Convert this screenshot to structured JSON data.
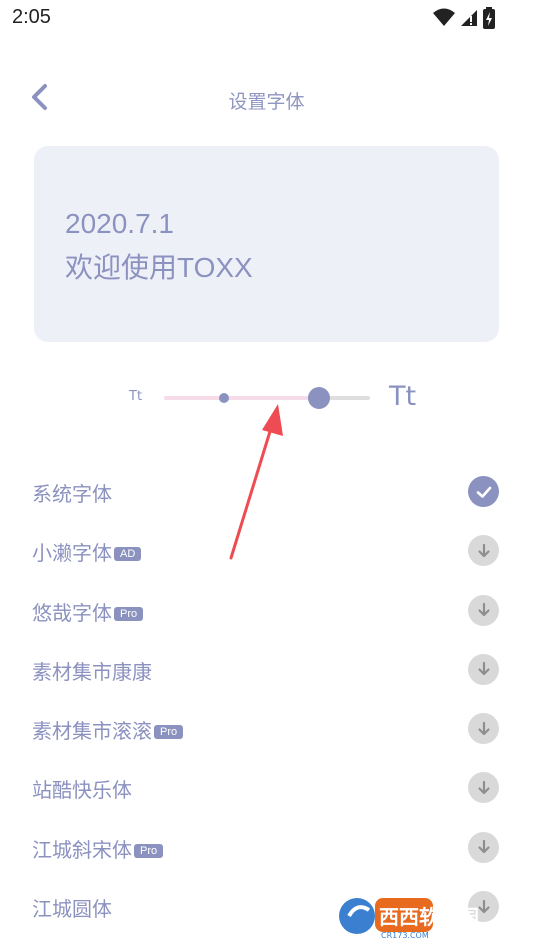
{
  "status_bar": {
    "time": "2:05"
  },
  "header": {
    "title": "设置字体"
  },
  "preview": {
    "line1": "2020.7.1",
    "line2": "欢迎使用TOXX"
  },
  "size_slider": {
    "small_label": "Tt",
    "large_label": "Tt",
    "value_fraction": 0.75,
    "tick_fraction": 0.29
  },
  "fonts": [
    {
      "name": "系统字体",
      "badge": "",
      "status": "selected"
    },
    {
      "name": "小濑字体",
      "badge": "AD",
      "status": "download"
    },
    {
      "name": "悠哉字体",
      "badge": "Pro",
      "status": "download"
    },
    {
      "name": "素材集市康康",
      "badge": "",
      "status": "download"
    },
    {
      "name": "素材集市滚滚",
      "badge": "Pro",
      "status": "download"
    },
    {
      "name": "站酷快乐体",
      "badge": "",
      "status": "download"
    },
    {
      "name": "江城斜宋体",
      "badge": "Pro",
      "status": "download"
    },
    {
      "name": "江城圆体",
      "badge": "",
      "status": "download"
    }
  ],
  "watermark": {
    "text": "西西软件园",
    "sub": "CR173.COM"
  },
  "colors": {
    "accent": "#8b92bf",
    "preview_bg": "#eef0f8",
    "arrow": "#ef4b52"
  }
}
